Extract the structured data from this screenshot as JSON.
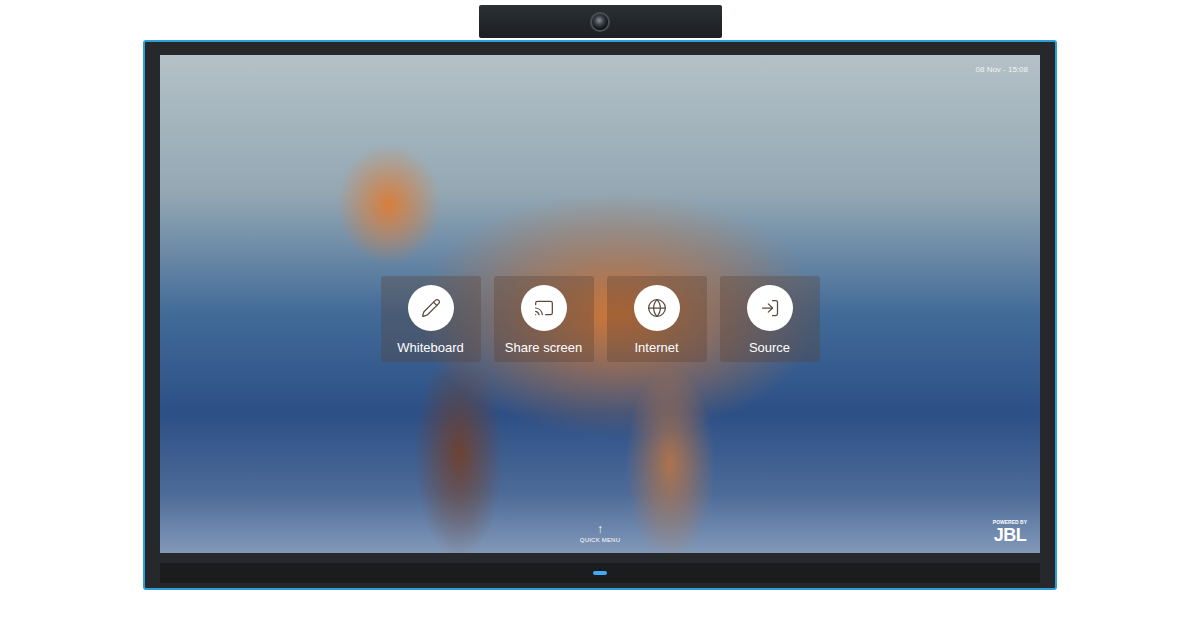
{
  "screen": {
    "clock": "08 Nov - 15:08"
  },
  "menu": {
    "items": [
      {
        "label": "Whiteboard"
      },
      {
        "label": "Share screen"
      },
      {
        "label": "Internet"
      },
      {
        "label": "Source"
      }
    ]
  },
  "quick_menu": {
    "arrow": "↑",
    "label": "QUICK MENU"
  },
  "branding": {
    "powered_by": "POWERED BY",
    "logo": "JBL"
  }
}
